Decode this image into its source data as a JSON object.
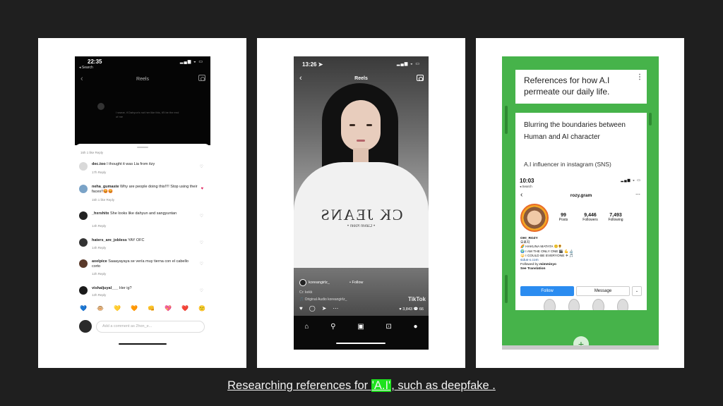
{
  "left_phone": {
    "time": "22:35",
    "back_label": "◂ Search",
    "title": "Reels",
    "blur_text": "I swear, if Dahyun's not her like this, it'll be the end of me",
    "cut_meta": "16h   1 like   Reply",
    "comments": [
      {
        "user": "dec.too",
        "text": "I thought it was Lia from itzy",
        "meta": "17h   Reply",
        "liked": false
      },
      {
        "user": "neha_gumaste",
        "text": "Why are people doing this!!!! Stop using their faces!!😡😡",
        "meta": "15h   1 like   Reply",
        "liked": true
      },
      {
        "user": "_hxrshitx",
        "text": "She looks like dahyun and sangyuntan",
        "meta": "14h   Reply",
        "liked": false
      },
      {
        "user": "haters_are_jobless",
        "text": "YAY OFC",
        "meta": "14h   Reply",
        "liked": false
      },
      {
        "user": "axelpice",
        "text": "Saaayayaya se vería muy tierna con el cabello corto",
        "meta": "12h   Reply",
        "liked": false
      },
      {
        "user": "vishaljuyal___",
        "text": "Her ig?",
        "meta": "12h   Reply",
        "liked": false
      }
    ],
    "emojis": [
      "💙",
      "🐵",
      "💛",
      "🧡",
      "👊",
      "💖",
      "❤️",
      "😕"
    ],
    "comment_placeholder": "Add a comment as 2hon_e..."
  },
  "mid_phone": {
    "time": "13:26 ➤",
    "title": "Reels",
    "shirt_text": "CK JEANS",
    "shirt_sub": "• Calvin Klein •",
    "watermark": "TikTok",
    "username": "koreangirlz_",
    "follow_label": "• Follow",
    "caption": "Cr: kekk",
    "audio": "🎵 Original Audio  koreangirlz_",
    "likes": "♥ 3,843",
    "comments_count": "💬 66"
  },
  "right_panel": {
    "card1_title": "References for how A.I permeate our daily life.",
    "card2_title": "Blurring the boundaries between Human and AI character",
    "card2_sub": "A.I influencer in instagram (SNS)",
    "ig": {
      "time": "10:03",
      "back_label": "◂ Search",
      "username": "rozy.gram",
      "posts": "99",
      "posts_label": "Posts",
      "followers": "9,446",
      "followers_label": "Followers",
      "following": "7,493",
      "following_label": "Following",
      "name": "OH!_ROZY",
      "bio_korean": "오로지",
      "bio_line1": "🌈 HAKUNA MATATA 😊🌻",
      "bio_line2": "🌍 I AM THE ONLY ONE 🎬 💪 🔬",
      "bio_line3": "🔱 I COULD BE EVERYONE ✈ 🎵",
      "bio_link": "sidus-x.com",
      "followed_by": "Followed by ",
      "followed_by_user": "mimminyo",
      "see_translation": "See Translation",
      "follow_button": "Follow",
      "message_button": "Message"
    }
  },
  "caption": {
    "before": "Researching references for ",
    "highlight": "'A.I'",
    "after": ", such as deepfake ."
  },
  "colors": {
    "background": "#1f1f1f",
    "green": "#46b34a",
    "highlight": "#1ee21e",
    "ig_blue": "#2b8cf0"
  }
}
